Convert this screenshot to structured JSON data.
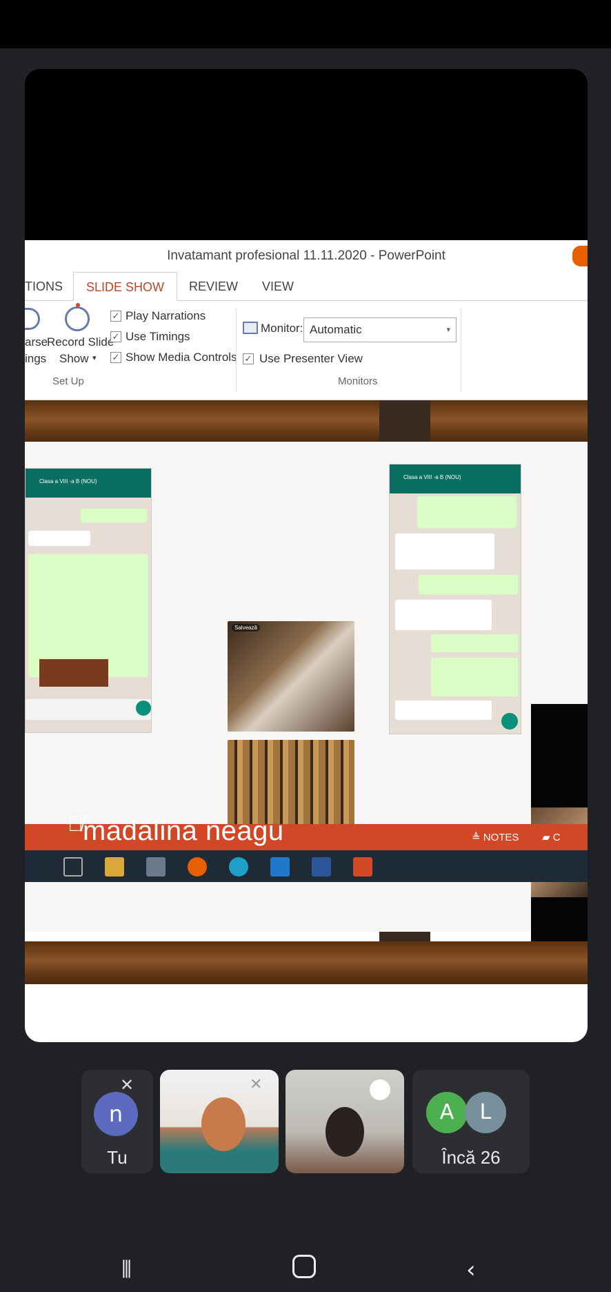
{
  "ppt": {
    "title": "Invatamant profesional 11.11.2020 - PowerPoint",
    "tabs": [
      "TIONS",
      "SLIDE SHOW",
      "REVIEW",
      "VIEW"
    ],
    "active_tab": "SLIDE SHOW",
    "ribbon": {
      "rehearse_line1": "arse",
      "rehearse_line2": "ings",
      "record_line1": "Record Slide",
      "record_line2": "Show",
      "record_caret": "▾",
      "checkboxes": [
        "Play Narrations",
        "Use Timings",
        "Show Media Controls"
      ],
      "group_setup": "Set Up",
      "monitor_label": "Monitor:",
      "monitor_value": "Automatic",
      "presenter_view": "Use Presenter View",
      "group_monitors": "Monitors"
    },
    "notes_label": "NOTES",
    "comments_label": "C"
  },
  "presenter_name": "madalina neagu",
  "slide": {
    "left_phone_header": "Clasa a VIII -a B (NOU)",
    "right_phone_header": "Clasa a VIII -a B (NOU)",
    "photo_badge": "Salvează"
  },
  "participants": {
    "self_initial": "n",
    "self_label": "Tu",
    "more_initials": [
      "A",
      "L"
    ],
    "more_label": "Încă 26"
  },
  "colors": {
    "accent_orange": "#d24726",
    "avatar_self": "#5c6bc0",
    "avatar_a": "#4caf50",
    "avatar_l": "#78909c"
  },
  "icons": {
    "mic_off": "mic-off-icon",
    "audio": "audio-level-icon",
    "nav_recents": "recents-icon",
    "nav_home": "home-icon",
    "nav_back": "back-icon"
  }
}
